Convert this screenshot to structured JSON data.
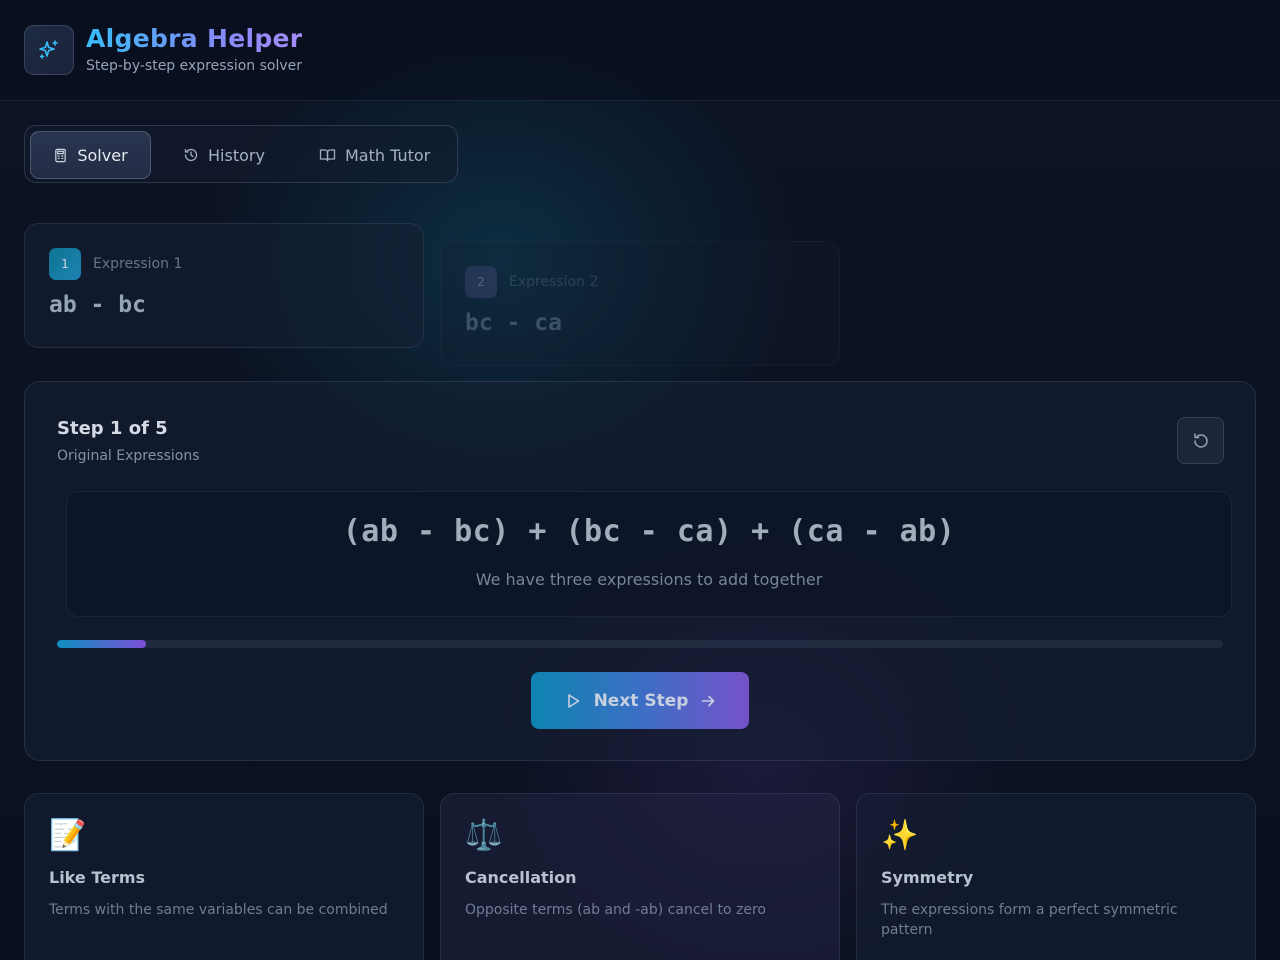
{
  "app": {
    "title": "Algebra Helper",
    "subtitle": "Step-by-step expression solver",
    "logo_icon": "sparkles-icon"
  },
  "tabs": [
    {
      "label": "Solver",
      "icon": "calculator-icon",
      "active": true
    },
    {
      "label": "History",
      "icon": "history-icon",
      "active": false
    },
    {
      "label": "Math Tutor",
      "icon": "book-open-icon",
      "active": false
    }
  ],
  "expressions": [
    {
      "number": "1",
      "label": "Expression 1",
      "value": "ab - bc"
    },
    {
      "number": "2",
      "label": "Expression 2",
      "value": "bc - ca"
    }
  ],
  "solver": {
    "step_title": "Step 1 of 5",
    "step_subtitle": "Original Expressions",
    "equation": "(ab - bc) + (bc - ca) + (ca - ab)",
    "equation_description": "We have three expressions to add together",
    "progress_fraction": 0.076,
    "next_label": "Next Step",
    "reset_icon": "rotate-ccw-icon"
  },
  "info_cards": [
    {
      "emoji": "📝",
      "title": "Like Terms",
      "description": "Terms with the same variables can be combined"
    },
    {
      "emoji": "⚖️",
      "title": "Cancellation",
      "description": "Opposite terms (ab and -ab) cancel to zero"
    },
    {
      "emoji": "✨",
      "title": "Symmetry",
      "description": "The expressions form a perfect symmetric pattern"
    }
  ],
  "colors": {
    "accent_cyan": "#38bdf8",
    "accent_violet": "#a78bfa",
    "background": "#0b1120"
  }
}
